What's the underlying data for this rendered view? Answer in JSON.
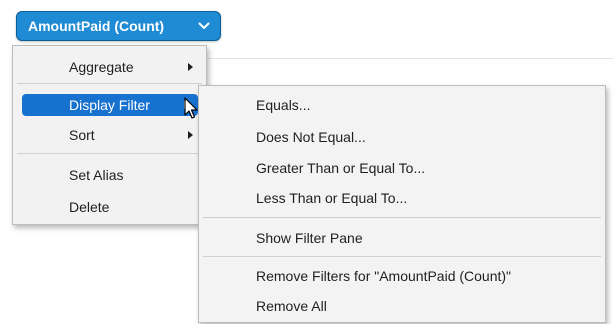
{
  "pill": {
    "label": "AmountPaid (Count)",
    "icon": "chevron-down-icon",
    "color": "#1e8bd4"
  },
  "context_menu": {
    "items": [
      {
        "label": "Aggregate",
        "submenu": true
      },
      {
        "label": "Display Filter",
        "submenu": true,
        "highlighted": true
      },
      {
        "label": "Sort",
        "submenu": true
      },
      {
        "label": "Set Alias"
      },
      {
        "label": "Delete"
      }
    ]
  },
  "submenu": {
    "items": [
      {
        "label": "Equals..."
      },
      {
        "label": "Does Not Equal..."
      },
      {
        "label": "Greater Than or Equal To..."
      },
      {
        "label": "Less Than or Equal To..."
      },
      {
        "label": "Show Filter Pane"
      },
      {
        "label": "Remove Filters for \"AmountPaid (Count)\""
      },
      {
        "label": "Remove All"
      }
    ]
  },
  "highlight_color": "#1771cf",
  "cursor": {
    "icon": "mouse-pointer-icon"
  }
}
